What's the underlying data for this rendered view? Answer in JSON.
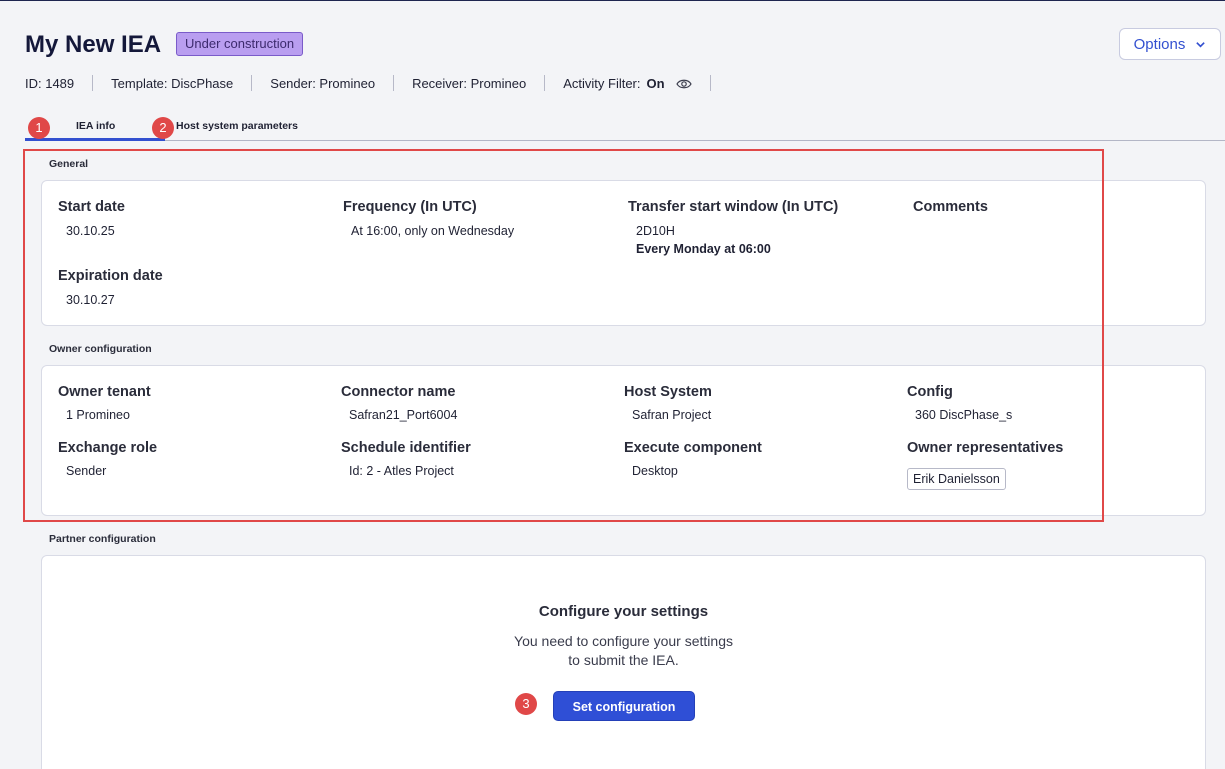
{
  "header": {
    "title": "My New IEA",
    "status": "Under construction",
    "options_label": "Options"
  },
  "meta": {
    "id": "ID: 1489",
    "template": "Template: DiscPhase",
    "sender": "Sender: Promineo",
    "receiver": "Receiver: Promineo",
    "activity_filter_label": "Activity Filter:",
    "activity_filter_value": "On"
  },
  "tabs": [
    {
      "label": "IEA info",
      "active": true
    },
    {
      "label": "Host system parameters",
      "active": false
    }
  ],
  "markers": [
    "1",
    "2",
    "3"
  ],
  "general": {
    "section_label": "General",
    "start_date_label": "Start date",
    "start_date": "30.10.25",
    "frequency_label": "Frequency (In UTC)",
    "frequency": "At 16:00, only on Wednesday",
    "transfer_label": "Transfer start window (In UTC)",
    "transfer_value": "2D10H",
    "transfer_schedule": "Every Monday at 06:00",
    "comments_label": "Comments",
    "expiration_label": "Expiration date",
    "expiration_date": "30.10.27"
  },
  "owner": {
    "section_label": "Owner configuration",
    "owner_tenant_label": "Owner tenant",
    "owner_tenant": "1 Promineo",
    "connector_label": "Connector name",
    "connector": "Safran21_Port6004",
    "host_system_label": "Host System",
    "host_system": "Safran Project",
    "config_label": "Config",
    "config": "360 DiscPhase_s",
    "exchange_role_label": "Exchange role",
    "exchange_role": "Sender",
    "schedule_label": "Schedule identifier",
    "schedule": "Id: 2 - Atles Project",
    "execute_label": "Execute component",
    "execute": "Desktop",
    "reps_label": "Owner representatives",
    "reps": [
      "Erik Danielsson"
    ]
  },
  "partner": {
    "section_label": "Partner configuration",
    "empty_title": "Configure your settings",
    "empty_line1": "You need to configure your settings",
    "empty_line2": "to submit the IEA.",
    "button_label": "Set configuration"
  },
  "colors": {
    "accent": "#2f4fd6",
    "badge": "#b99ef0",
    "highlight": "#e04848"
  }
}
